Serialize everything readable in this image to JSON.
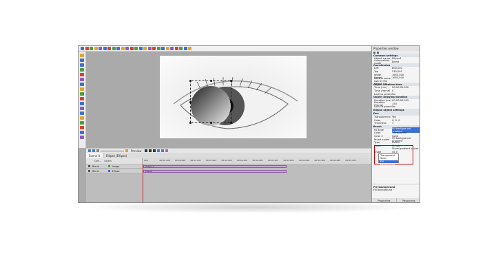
{
  "toolbar": {
    "icons": [
      "new-icon",
      "open-icon",
      "save-icon",
      "cut-icon",
      "copy-icon",
      "paste-icon",
      "undo-icon",
      "redo-icon",
      "text-icon",
      "image-icon",
      "video-icon",
      "audio-icon",
      "shape-icon",
      "chart-icon",
      "export-icon"
    ],
    "colors": [
      "#3b6fd1",
      "#d8402b",
      "#4b9e3c",
      "#e2a52b",
      "#8a5bc2",
      "#3b6fd1",
      "#d8402b",
      "#4b9e3c",
      "#3b6fd1",
      "#e2a52b",
      "#8a5bc2",
      "#d8402b",
      "#4b9e3c",
      "#3b6fd1",
      "#e2a52b",
      "#8a5bc2",
      "#d8402b",
      "#4b9e3c",
      "#3b6fd1",
      "#e2a52b",
      "#8a5bc2",
      "#d8402b",
      "#4b9e3c",
      "#3b6fd1",
      "#e2a52b"
    ]
  },
  "timeline": {
    "preview_label": "Preview",
    "scene_tabs": [
      "Scene 0",
      "Ellipse (Ellipse)"
    ],
    "headers": {
      "com": "Com...",
      "layers": "Layers"
    },
    "ruler_ticks": [
      "000",
      "00:00.400",
      "00:00.800",
      "00:01.201",
      "00:01.601",
      "00:02.002",
      "00:02.402",
      "00:02.803",
      "00:03.203",
      "00:03.603",
      "00:04.004",
      "00:04.404",
      "00:04.805",
      "00:05.205"
    ],
    "rows": [
      {
        "mode": "Blend",
        "layer": "Image",
        "clip": "Image_1"
      },
      {
        "mode": "Blend",
        "layer": "Ellipse",
        "clip": "Ellipse"
      }
    ]
  },
  "properties": {
    "title": "Properties window",
    "sections": [
      {
        "heading": "Common settings",
        "rows": [
          [
            "Object name",
            "Ellipse1"
          ],
          [
            "Composition mode",
            "Blend"
          ]
        ]
      },
      {
        "heading": "Coordinates",
        "rows": [
          [
            "Left",
            "800,000"
          ],
          [
            "Top",
            "535,000"
          ],
          [
            "Width",
            "1653,000"
          ],
          [
            "Height",
            "1653,000"
          ],
          [
            "Set the same size as the parent has",
            ""
          ]
        ]
      },
      {
        "heading": "Object creation time",
        "rows": [
          [
            "Time (ms)",
            "00:00:00.000"
          ],
          [
            "Time (frame)",
            "0"
          ],
          [
            "Lock to parent",
            "No"
          ]
        ]
      },
      {
        "heading": "Object drawing duration",
        "rows": [
          [
            "Duration (ms)",
            "00:00:05.005"
          ],
          [
            "Duration (frame)",
            "150"
          ],
          [
            "Lock to parent",
            "No"
          ]
        ]
      },
      {
        "heading": "Ellipse object settings",
        "rows": []
      },
      {
        "heading": "Pen",
        "rows": [
          [
            "Transparency",
            "Yes"
          ],
          [
            "Color",
            "0; 0; 0"
          ],
          [
            "Thickness",
            "1"
          ]
        ]
      },
      {
        "heading": "Brush",
        "rows": [
          [
            "Fill type",
            "Fill background gradient"
          ],
          [
            "Color",
            "Transparent"
          ],
          [
            "Color 2",
            "Solid"
          ],
          [
            "Invert colors",
            "Fill background gradient"
          ]
        ]
      },
      {
        "heading": "",
        "rows": [
          [
            "Type",
            "Linear"
          ],
          [
            "Mode",
            "Simple"
          ],
          [
            "",
            "Show gradient vector"
          ],
          [
            "Angle",
            "45,0"
          ]
        ]
      }
    ],
    "dropdown_options": [
      "Transparent",
      "Solid",
      "Fill background gradient"
    ],
    "description_title": "Fill background",
    "description_text": "Fill background",
    "tabs": [
      "Properties",
      "Resources"
    ]
  }
}
